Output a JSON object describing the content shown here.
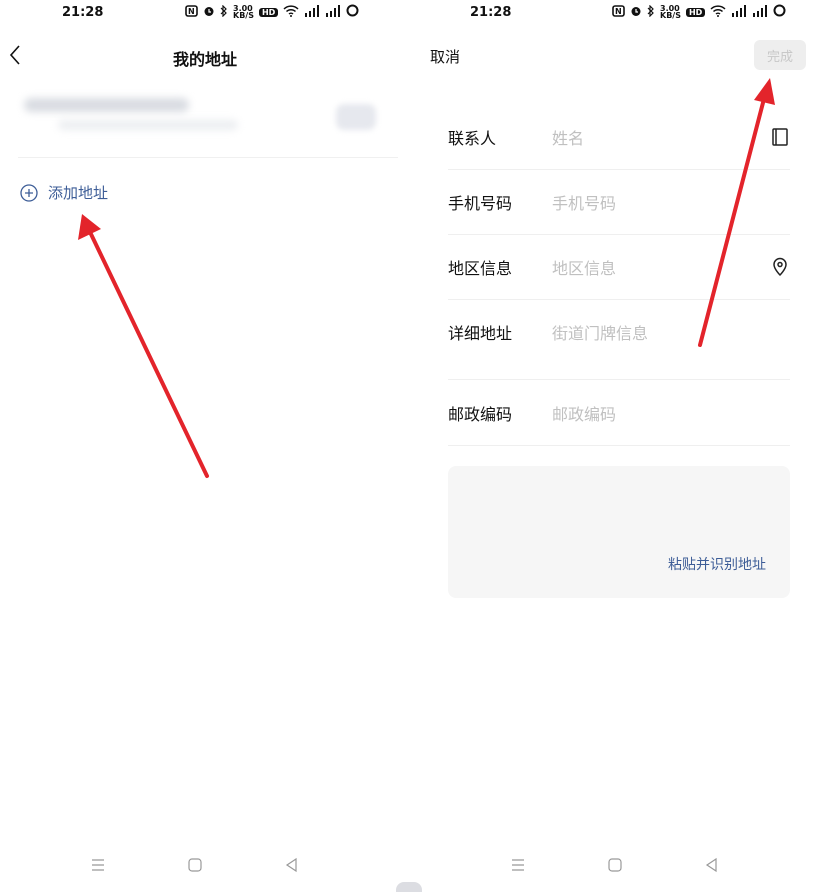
{
  "left": {
    "status": {
      "time": "21:28",
      "icons": [
        "nfc-icon",
        "alarm-icon",
        "bluetooth-icon",
        "net-speed-icon",
        "hd-icon",
        "wifi-icon",
        "signal-icon",
        "signal-icon",
        "battery-icon"
      ],
      "net_speed": "3.00\nKB/S",
      "hd": "HD"
    },
    "nav": {
      "title": "我的地址",
      "back_icon": "chevron-left-icon"
    },
    "add_address_label": "添加地址"
  },
  "right": {
    "status": {
      "time": "21:28",
      "net_speed": "3.00\nKB/S",
      "hd": "HD"
    },
    "header": {
      "cancel_label": "取消",
      "done_label": "完成"
    },
    "form": {
      "name": {
        "label": "联系人",
        "placeholder": "姓名",
        "icon": "address-book-icon"
      },
      "phone": {
        "label": "手机号码",
        "placeholder": "手机号码"
      },
      "region": {
        "label": "地区信息",
        "placeholder": "地区信息",
        "icon": "location-pin-icon"
      },
      "detail": {
        "label": "详细地址",
        "placeholder": "街道门牌信息"
      },
      "postcode": {
        "label": "邮政编码",
        "placeholder": "邮政编码"
      }
    },
    "paste_label": "粘贴并识别地址"
  },
  "colors": {
    "accent": "#3d5d97",
    "arrow": "#e3242b",
    "placeholder": "#c0c0c0"
  }
}
